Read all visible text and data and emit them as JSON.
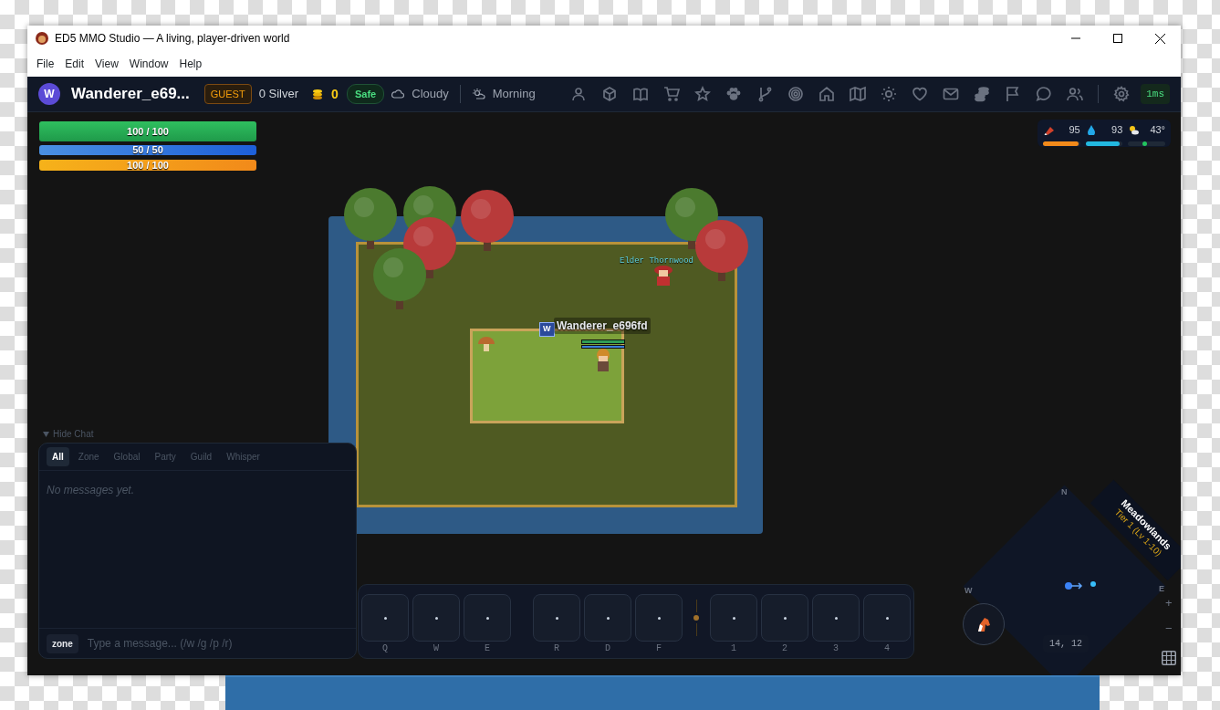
{
  "window": {
    "title": "ED5 MMO Studio — A living, player-driven world"
  },
  "menu": [
    "File",
    "Edit",
    "View",
    "Window",
    "Help"
  ],
  "topbar": {
    "avatar_letter": "W",
    "player_name": "Wanderer_e69...",
    "account_badge": "GUEST",
    "silver": "0 Silver",
    "gold": "0",
    "zone_status": "Safe",
    "weather": "Cloudy",
    "time_of_day": "Morning",
    "ping": "1ms"
  },
  "bars": [
    {
      "kind": "health",
      "text": "100 / 100",
      "level": 1
    },
    {
      "kind": "mana",
      "text": "50 / 50",
      "level": 1
    },
    {
      "kind": "stamina",
      "text": "100 / 100",
      "level": 1
    }
  ],
  "survival": [
    {
      "kind": "hunger",
      "reading": "95",
      "level": 0.95
    },
    {
      "kind": "thirst",
      "reading": "93",
      "level": 0.93
    },
    {
      "kind": "temperature",
      "reading": "43°",
      "level": 0.43
    }
  ],
  "world": {
    "npc_name": "Elder Thornwood",
    "player_tag": "W",
    "player_name": "Wanderer_e696fd"
  },
  "chat": {
    "toggle": "Hide Chat",
    "tabs": [
      {
        "label": "All",
        "selected": true
      },
      {
        "label": "Zone",
        "selected": false
      },
      {
        "label": "Global",
        "selected": false
      },
      {
        "label": "Party",
        "selected": false
      },
      {
        "label": "Guild",
        "selected": false
      },
      {
        "label": "Whisper",
        "selected": false
      }
    ],
    "empty_message": "No messages yet.",
    "channel": "zone",
    "placeholder": "Type a message... (/w /g /p /r)"
  },
  "hotbar": {
    "groups": [
      [
        "Q",
        "W",
        "E"
      ],
      [
        "R",
        "D",
        "F"
      ],
      [
        "1",
        "2",
        "3",
        "4"
      ]
    ]
  },
  "minimap": {
    "compass": [
      "N",
      "W",
      "E"
    ],
    "zone_name": "Meadowlands",
    "zone_tier": "Tier 1 (Lv 1-10)",
    "coordinates": "14, 12",
    "zoom_in": "+",
    "zoom_out": "−"
  }
}
